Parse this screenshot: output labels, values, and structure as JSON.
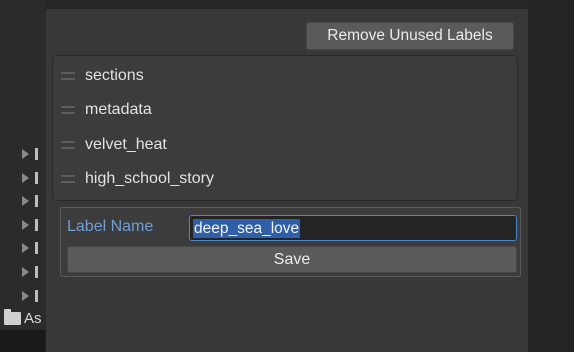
{
  "background": {
    "folder_label": "As"
  },
  "toolbar": {
    "remove_unused_label": "Remove Unused Labels"
  },
  "labels": {
    "items": [
      {
        "name": "sections"
      },
      {
        "name": "metadata"
      },
      {
        "name": "velvet_heat"
      },
      {
        "name": "high_school_story"
      }
    ]
  },
  "form": {
    "field_label": "Label Name",
    "value": "deep_sea_love",
    "save_label": "Save"
  },
  "colors": {
    "accent": "#4a86c8",
    "field_label": "#6e9fd6",
    "selection": "#2f5fa8"
  }
}
